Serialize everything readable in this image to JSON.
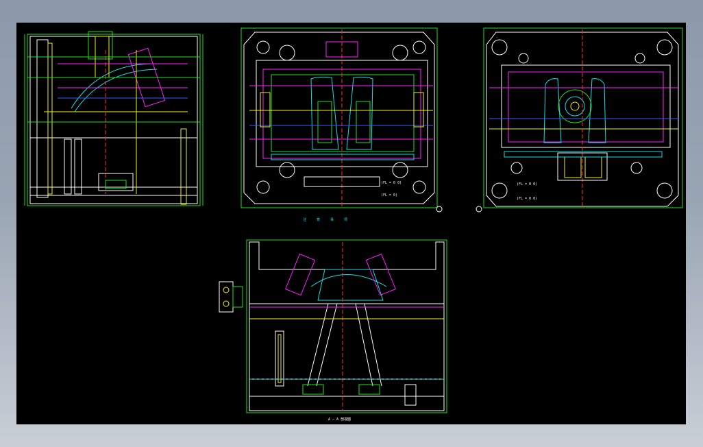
{
  "drawing": {
    "colors": {
      "white": "#ffffff",
      "green": "#1be31b",
      "yellow": "#f2f21a",
      "magenta": "#ff22ff",
      "cyan": "#19e0e6",
      "blue": "#3c5cff",
      "red": "#ff3030"
    },
    "labels": {
      "view2_scale": "(FL = 0 0)",
      "view2_scale2": "(FL = 0)",
      "view3_scale": "(FL = 0 0)",
      "view3_scale2": "(FL = 0 0)",
      "section_title": "A — A  剖视图",
      "notes": "注 意 事 项"
    }
  }
}
